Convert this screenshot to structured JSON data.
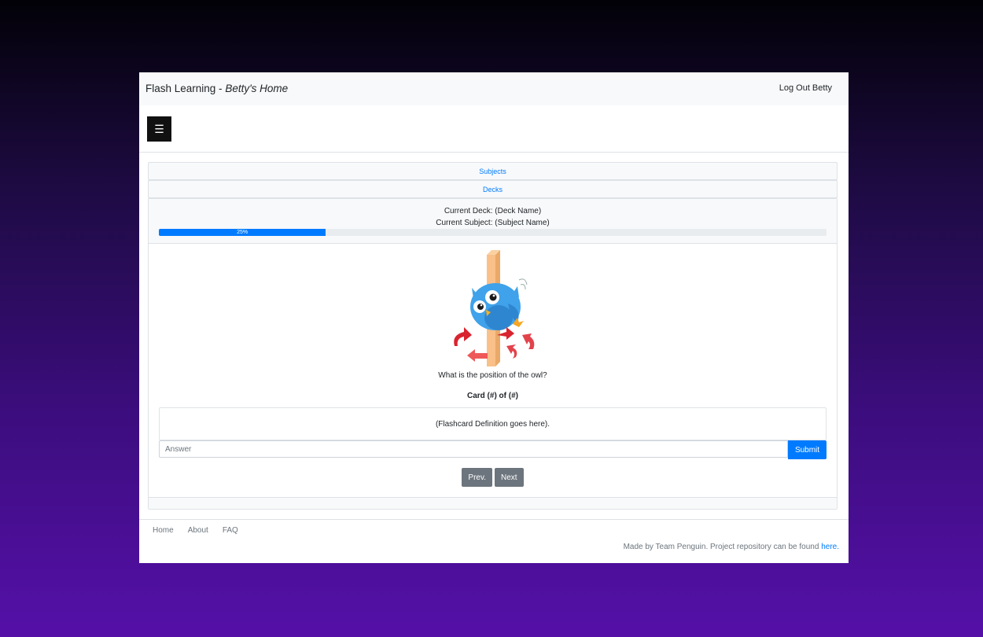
{
  "header": {
    "brand": "Flash Learning - ",
    "brand_sub": "Betty's Home",
    "logout": "Log Out Betty",
    "menu_icon": "☰"
  },
  "accordion": {
    "subjects": "Subjects",
    "decks": "Decks"
  },
  "card": {
    "current_deck": "Current Deck: (Deck Name)",
    "current_subject": "Current Subject: (Subject Name)",
    "progress_label": "25%",
    "progress_value": 25,
    "question": "What is the position of the owl?",
    "counter": "Card (#) of (#)",
    "definition": "(Flashcard Definition goes here).",
    "answer_placeholder": "Answer",
    "submit_label": "Submit",
    "prev_label": "Prev.",
    "next_label": "Next"
  },
  "footer": {
    "links": [
      "Home",
      "About",
      "FAQ"
    ],
    "credit_text": "Made by Team Penguin. Project repository can be found ",
    "credit_link": "here."
  },
  "colors": {
    "primary": "#007bff",
    "secondary": "#6c757d",
    "owl": "#3fa2ea"
  }
}
